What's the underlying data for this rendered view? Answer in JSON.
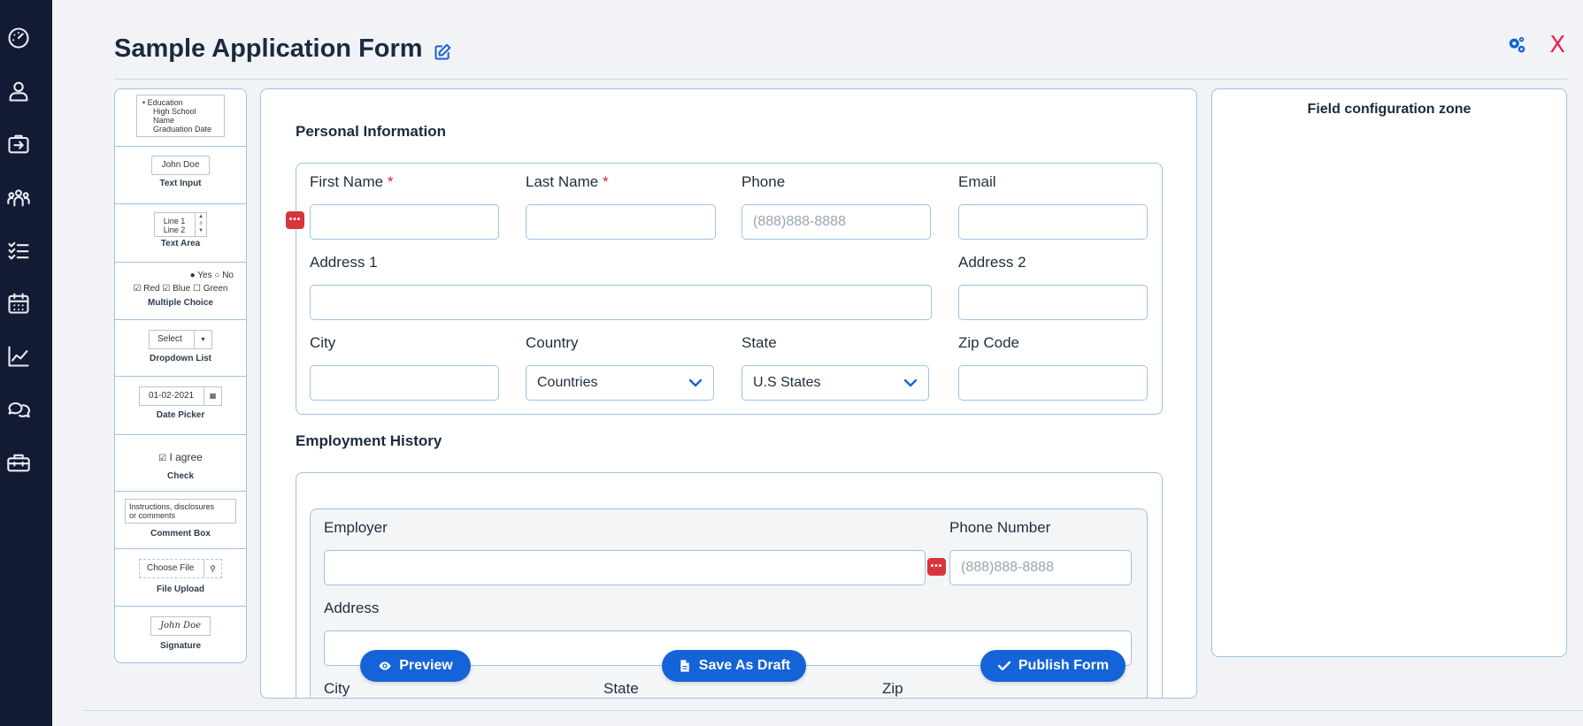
{
  "header": {
    "title": "Sample Application Form",
    "close_label": "X"
  },
  "nav": {
    "icons": [
      "dashboard-icon",
      "user-icon",
      "export-icon",
      "team-icon",
      "checklist-icon",
      "calendar-icon",
      "chart-icon",
      "chat-icon",
      "toolbox-icon"
    ]
  },
  "palette": {
    "education": {
      "bullet": "• Education",
      "line1": "High School Name",
      "line2": "Graduation Date"
    },
    "text_input": {
      "sample": "John Doe",
      "label": "Text Input"
    },
    "text_area": {
      "line1": "Line 1",
      "line2": "Line 2",
      "label": "Text Area"
    },
    "multiple_choice": {
      "yes": "Yes",
      "no": "No",
      "red": "Red",
      "blue": "Blue",
      "green": "Green",
      "label": "Multiple Choice"
    },
    "dropdown": {
      "sample": "Select",
      "label": "Dropdown List"
    },
    "date_picker": {
      "sample": "01-02-2021",
      "label": "Date Picker"
    },
    "check": {
      "sample": "I agree",
      "label": "Check"
    },
    "comment_box": {
      "line1": "Instructions, disclosures",
      "line2": "or comments",
      "label": "Comment Box"
    },
    "file_upload": {
      "sample": "Choose File",
      "label": "File Upload"
    },
    "signature": {
      "sample": "John Doe",
      "label": "Signature"
    }
  },
  "personal": {
    "title": "Personal Information",
    "first_name": "First Name",
    "last_name": "Last Name",
    "required_mark": "*",
    "phone": "Phone",
    "phone_placeholder": "(888)888-8888",
    "email": "Email",
    "address1": "Address 1",
    "address2": "Address 2",
    "city": "City",
    "country": "Country",
    "country_value": "Countries",
    "state": "State",
    "state_value": "U.S States",
    "zip": "Zip Code"
  },
  "employment": {
    "title": "Employment History",
    "employer": "Employer",
    "phone_number": "Phone Number",
    "phone_placeholder": "(888)888-8888",
    "address": "Address",
    "city": "City",
    "state": "State",
    "zip": "Zip"
  },
  "actions": {
    "preview": "Preview",
    "save_draft": "Save As Draft",
    "publish": "Publish Form"
  },
  "config": {
    "title": "Field configuration zone"
  },
  "colors": {
    "accent": "#1463d8",
    "nav_bg": "#131a33",
    "danger": "#d8353a",
    "close": "#e0254a"
  }
}
